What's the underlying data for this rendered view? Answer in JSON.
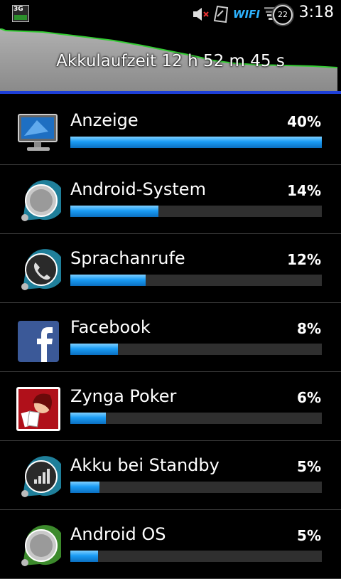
{
  "status_bar": {
    "network_badge": "3G",
    "wifi_label": "WIFI",
    "notification_count": "22",
    "time": "3:18"
  },
  "graph": {
    "title": "Akkulaufzeit 12 h 52 m 45 s"
  },
  "items": [
    {
      "label": "Anzeige",
      "percent_text": "40%",
      "level": 1.0,
      "icon": "monitor-icon"
    },
    {
      "label": "Android-System",
      "percent_text": "14%",
      "level": 0.35,
      "icon": "android-system-icon"
    },
    {
      "label": "Sprachanrufe",
      "percent_text": "12%",
      "level": 0.3,
      "icon": "phone-call-icon"
    },
    {
      "label": "Facebook",
      "percent_text": "8%",
      "level": 0.19,
      "icon": "facebook-icon"
    },
    {
      "label": "Zynga Poker",
      "percent_text": "6%",
      "level": 0.14,
      "icon": "zynga-poker-icon"
    },
    {
      "label": "Akku bei Standby",
      "percent_text": "5%",
      "level": 0.115,
      "icon": "signal-standby-icon"
    },
    {
      "label": "Android OS",
      "percent_text": "5%",
      "level": 0.11,
      "icon": "android-os-icon"
    }
  ],
  "colors": {
    "bar": "#1a9cf5",
    "graph_line": "#33cc33",
    "graph_fill": "#9a9a9a"
  }
}
